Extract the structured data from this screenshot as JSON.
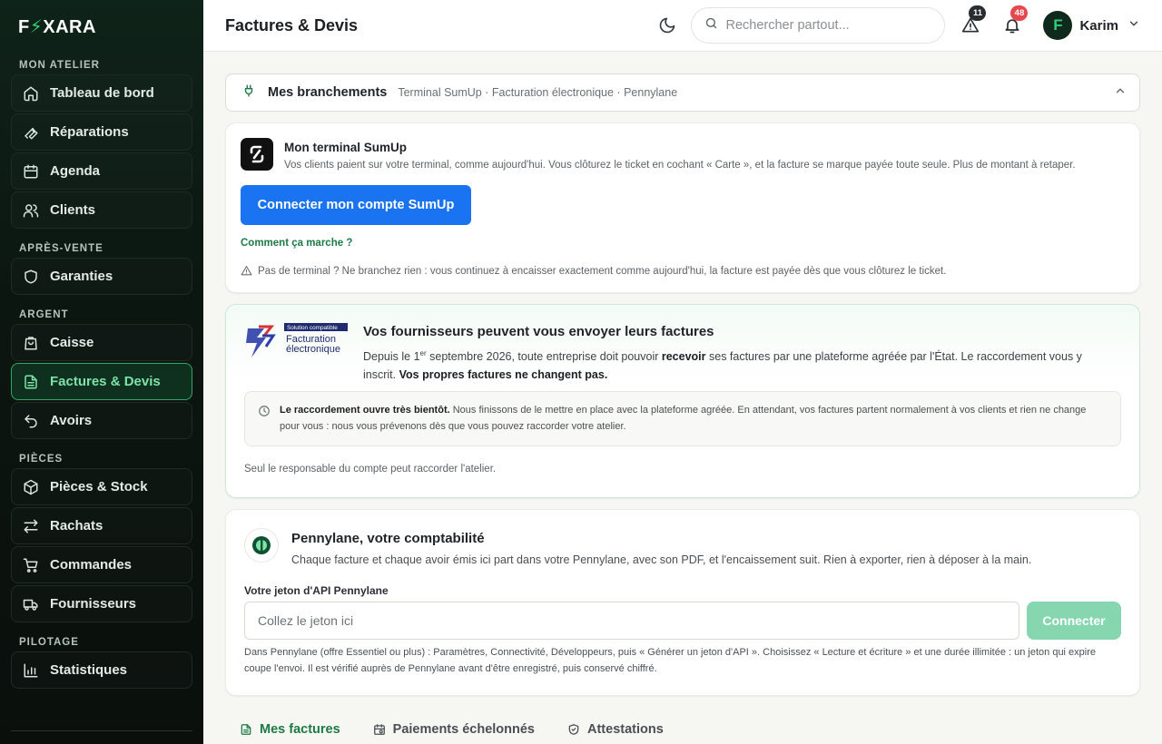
{
  "brand": {
    "logo_pre": "F",
    "logo_bolt": "⚡",
    "logo_post": "XARA"
  },
  "sidebar": {
    "sections": [
      {
        "title": "MON ATELIER",
        "items": [
          "Tableau de bord",
          "Réparations",
          "Agenda",
          "Clients"
        ]
      },
      {
        "title": "APRÈS-VENTE",
        "items": [
          "Garanties"
        ]
      },
      {
        "title": "ARGENT",
        "items": [
          "Caisse",
          "Factures & Devis",
          "Avoirs"
        ]
      },
      {
        "title": "PIÈCES",
        "items": [
          "Pièces & Stock",
          "Rachats",
          "Commandes",
          "Fournisseurs"
        ]
      },
      {
        "title": "PILOTAGE",
        "items": [
          "Statistiques"
        ]
      }
    ],
    "active_item": "Factures & Devis"
  },
  "header": {
    "title": "Factures & Devis",
    "search_placeholder": "Rechercher partout...",
    "alerts_count": "11",
    "notifications_count": "48",
    "user_initial": "F",
    "user_name": "Karim"
  },
  "connections": {
    "title": "Mes branchements",
    "subtitle": "Terminal SumUp · Facturation électronique · Pennylane"
  },
  "sumup": {
    "title": "Mon terminal SumUp",
    "description": "Vos clients paient sur votre terminal, comme aujourd'hui. Vous clôturez le ticket en cochant « Carte », et la facture se marque payée toute seule. Plus de montant à retaper.",
    "button": "Connecter mon compte SumUp",
    "how_link": "Comment ça marche ?",
    "note": "Pas de terminal ? Ne branchez rien : vous continuez à encaisser exactement comme aujourd'hui, la facture est payée dès que vous clôturez le ticket."
  },
  "einvoicing": {
    "logo_tag": "Solution compatible",
    "logo_line1": "Facturation",
    "logo_line2": "électronique",
    "title": "Vos fournisseurs peuvent vous envoyer leurs factures",
    "text_1": "Depuis le 1",
    "text_sup": "er",
    "text_2": " septembre 2026, toute entreprise doit pouvoir ",
    "text_bold": "recevoir",
    "text_3": " ses factures par une plateforme agréée par l'État. Le raccordement vous y inscrit. ",
    "text_bold_2": "Vos propres factures ne changent pas.",
    "notice_bold": "Le raccordement ouvre très bientôt.",
    "notice_text": " Nous finissons de le mettre en place avec la plateforme agréée. En attendant, vos factures partent normalement à vos clients et rien ne change pour vous : nous vous prévenons dès que vous pouvez raccorder votre atelier.",
    "footer": "Seul le responsable du compte peut raccorder l'atelier."
  },
  "pennylane": {
    "title": "Pennylane, votre comptabilité",
    "description": "Chaque facture et chaque avoir émis ici part dans votre Pennylane, avec son PDF, et l'encaissement suit. Rien à exporter, rien à déposer à la main.",
    "field_label": "Votre jeton d'API Pennylane",
    "field_placeholder": "Collez le jeton ici",
    "button": "Connecter",
    "help": "Dans Pennylane (offre Essentiel ou plus) : Paramètres, Connectivité, Développeurs, puis « Générer un jeton d'API ». Choisissez « Lecture et écriture » et une durée illimitée : un jeton qui expire coupe l'envoi. Il est vérifié auprès de Pennylane avant d'être enregistré, puis conservé chiffré."
  },
  "tabs": [
    "Mes factures",
    "Paiements échelonnés",
    "Attestations"
  ],
  "colors": {
    "accent": "#1d7a45",
    "primary_button": "#1a73f0",
    "badge_red": "#e5484d"
  }
}
